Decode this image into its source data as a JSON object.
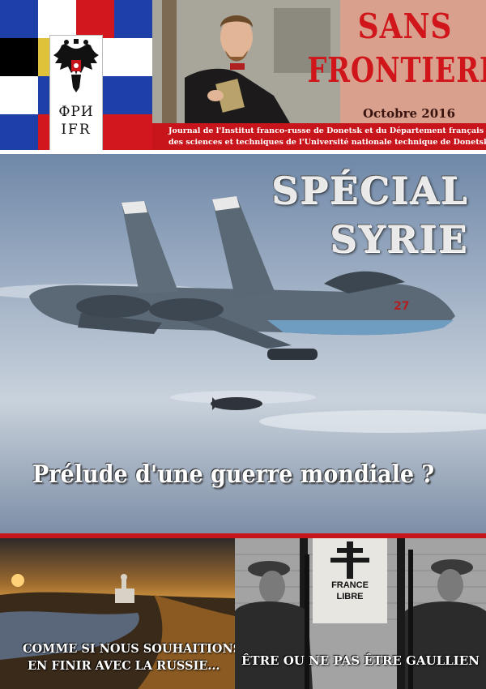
{
  "header": {
    "emblem_line1": "ФРИ",
    "emblem_line2": "IFR",
    "title_line1": "SANS",
    "title_line2": "FRONTIERES",
    "issue": "Octobre 2016",
    "journal_line1": "Journal de l'Institut franco-russe de Donetsk et du Département français",
    "journal_line2": "des sciences et techniques de l'Université nationale technique de Donetsk"
  },
  "hero": {
    "headline_line1": "SPÉCIAL",
    "headline_line2": "SYRIE",
    "subheadline": "Prélude d'une guerre mondiale ?"
  },
  "bottom_left": {
    "caption_line1": "COMME SI NOUS SOUHAITIONS",
    "caption_line2": "EN FINIR AVEC LA RUSSIE..."
  },
  "bottom_right": {
    "sign_line1": "FRANCE",
    "sign_line2": "LIBRE",
    "caption": "ÊTRE OU NE PAS ÊTRE GAULLIEN"
  },
  "colors": {
    "accent_red": "#c8151b",
    "header_bg": "#d9a18d",
    "flag_blue": "#1f3fa8",
    "flag_red": "#d2181e"
  },
  "icons": [
    "double-headed-eagle-icon",
    "cross-of-lorraine-icon"
  ]
}
